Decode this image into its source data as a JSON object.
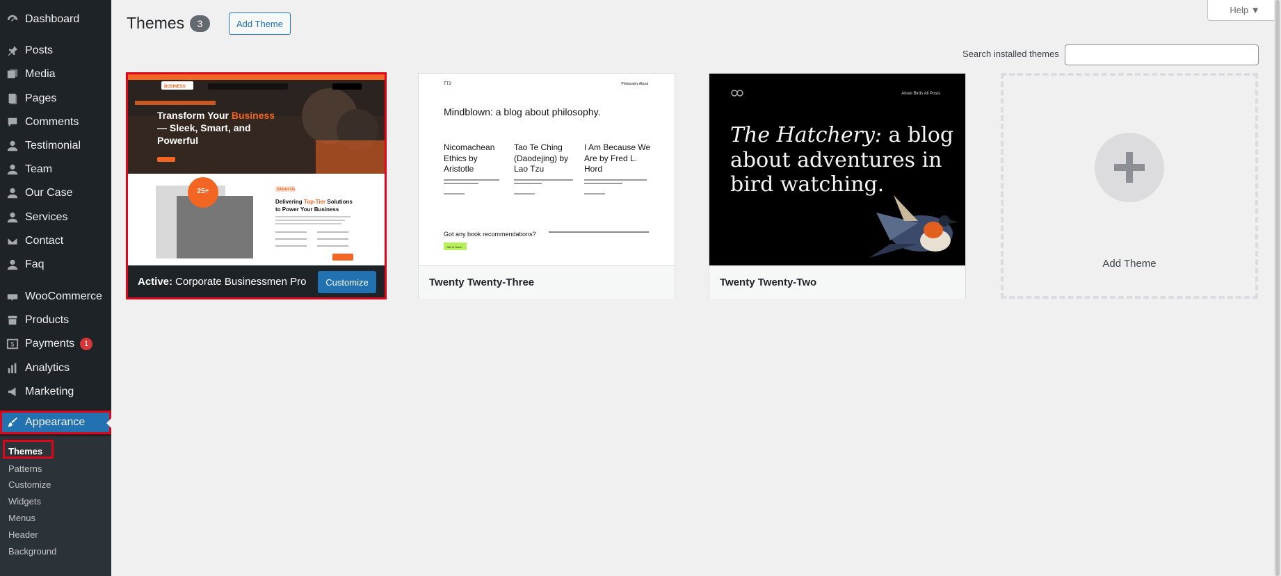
{
  "sidebar": {
    "items": [
      {
        "label": "Dashboard",
        "icon": "dashboard-icon"
      },
      {
        "label": "Posts",
        "icon": "pin-icon"
      },
      {
        "label": "Media",
        "icon": "media-icon"
      },
      {
        "label": "Pages",
        "icon": "pages-icon"
      },
      {
        "label": "Comments",
        "icon": "comment-icon"
      },
      {
        "label": "Testimonial",
        "icon": "user-icon"
      },
      {
        "label": "Team",
        "icon": "user-icon"
      },
      {
        "label": "Our Case",
        "icon": "user-icon"
      },
      {
        "label": "Services",
        "icon": "user-icon"
      },
      {
        "label": "Contact",
        "icon": "envelope-icon"
      },
      {
        "label": "Faq",
        "icon": "user-icon"
      },
      {
        "label": "WooCommerce",
        "icon": "woocommerce-icon"
      },
      {
        "label": "Products",
        "icon": "archive-icon"
      },
      {
        "label": "Payments",
        "icon": "dollar-icon",
        "badge": "1"
      },
      {
        "label": "Analytics",
        "icon": "bar-chart-icon"
      },
      {
        "label": "Marketing",
        "icon": "megaphone-icon"
      },
      {
        "label": "Appearance",
        "icon": "paintbrush-icon"
      }
    ],
    "submenu": [
      "Themes",
      "Patterns",
      "Customize",
      "Widgets",
      "Menus",
      "Header",
      "Background"
    ]
  },
  "header": {
    "title": "Themes",
    "count": "3",
    "add_button": "Add Theme",
    "help": "Help ▼"
  },
  "search": {
    "label": "Search installed themes",
    "value": ""
  },
  "themes": {
    "active": {
      "prefix": "Active:",
      "name": "Corporate Businessmen Pro",
      "customize": "Customize",
      "hero_title_1": "Transform Your ",
      "hero_accent": "Business",
      "hero_title_2": "— Sleek, Smart, and Powerful",
      "about_tag": "About Us",
      "about_title_1": "Delivering ",
      "about_accent": "Top-Tier",
      "about_title_2": " Solutions to Power Your Business",
      "badge": "25+",
      "brand": "BUSINESS"
    },
    "t23": {
      "name": "Twenty Twenty-Three",
      "site": "TT3",
      "nav": "Philosophy   About",
      "headline": "Mindblown: a blog about philosophy.",
      "posts": [
        "Nicomachean Ethics by Aristotle",
        "Tao Te Ching (Daodejing) by Lao Tzu",
        "I Am Because We Are by Fred L. Hord"
      ],
      "question": "Got any book recommendations?",
      "button": "Get In Touch"
    },
    "t22": {
      "name": "Twenty Twenty-Two",
      "nav": "About    Birds    All Posts",
      "headline_italic": "The Hatchery:",
      "headline_rest": " a blog about adventures in bird watching."
    },
    "add_label": "Add Theme"
  },
  "colors": {
    "sidebar": "#1d2327",
    "accent": "#2271b1",
    "highlight": "#e0061a",
    "orange": "#f26522"
  }
}
